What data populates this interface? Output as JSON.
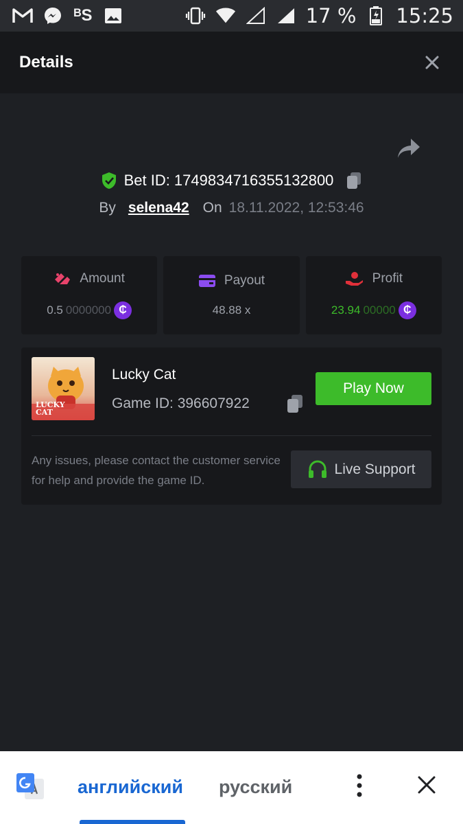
{
  "status_bar": {
    "left_icons": [
      "gmail-icon",
      "messenger-icon",
      "vpn-s-icon",
      "image-icon"
    ],
    "vpn_label": "ᴮS",
    "battery_percent": "17 %",
    "time": "15:25"
  },
  "header": {
    "title": "Details",
    "close_icon": "close-icon"
  },
  "bet": {
    "id_label": "Bet ID: 1749834716355132800",
    "by_label": "By",
    "username": "selena42",
    "on_label": "On",
    "date": "18.11.2022, 12:53:46"
  },
  "stats": {
    "amount": {
      "label": "Amount",
      "value_bright": "0.5",
      "value_dim": "0000000",
      "icon": "amount-icon"
    },
    "payout": {
      "label": "Payout",
      "value": "48.88 x",
      "icon": "wallet-icon"
    },
    "profit": {
      "label": "Profit",
      "value_bright": "23.94",
      "value_dim": "00000",
      "icon": "profit-icon"
    },
    "coin_symbol": "₵"
  },
  "game": {
    "thumb_text_line1": "LUCKY",
    "thumb_text_line2": "CAT",
    "name": "Lucky Cat",
    "id_label": "Game ID: 396607922",
    "play_label": "Play Now",
    "notice": "Any issues, please contact the customer service for help and provide the game ID.",
    "support_label": "Live Support"
  },
  "translate": {
    "lang_from": "английский",
    "lang_to": "русский"
  },
  "colors": {
    "accent_green": "#3dbb2a",
    "coin_purple": "#7b2fe0",
    "link_blue": "#1967d2"
  }
}
